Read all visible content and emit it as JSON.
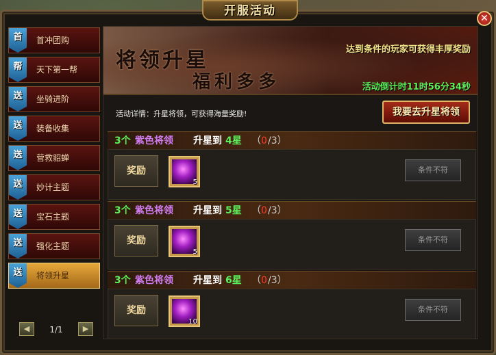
{
  "window": {
    "title": "开服活动",
    "close_glyph": "✕"
  },
  "sidebar": {
    "items": [
      {
        "badge": "首",
        "label": "首冲团购",
        "active": false
      },
      {
        "badge": "帮",
        "label": "天下第一帮",
        "active": false
      },
      {
        "badge": "送",
        "label": "坐骑进阶",
        "active": false
      },
      {
        "badge": "送",
        "label": "装备收集",
        "active": false
      },
      {
        "badge": "送",
        "label": "营救貂蝉",
        "active": false
      },
      {
        "badge": "送",
        "label": "妙计主题",
        "active": false
      },
      {
        "badge": "送",
        "label": "宝石主题",
        "active": false
      },
      {
        "badge": "送",
        "label": "强化主题",
        "active": false
      },
      {
        "badge": "送",
        "label": "将领升星",
        "active": true
      }
    ],
    "pager": {
      "text": "1/1",
      "prev_glyph": "◀",
      "next_glyph": "▶"
    }
  },
  "banner": {
    "title_line1": "将领升星",
    "title_line2": "福利多多",
    "subtitle": "达到条件的玩家可获得丰厚奖励",
    "countdown": "活动倒计时11时56分34秒"
  },
  "description": "活动详情：升星将领，可获得海量奖励!",
  "goto_button": "我要去升星将领",
  "tasks": [
    {
      "count": "3个",
      "quality": "紫色将领",
      "action": "升星到",
      "target": "4星",
      "open": "（",
      "progress": "0",
      "total": "/3）",
      "reward_label": "奖励",
      "item_count": "5",
      "status": "条件不符"
    },
    {
      "count": "3个",
      "quality": "紫色将领",
      "action": "升星到",
      "target": "5星",
      "open": "（",
      "progress": "0",
      "total": "/3）",
      "reward_label": "奖励",
      "item_count": "5",
      "status": "条件不符"
    },
    {
      "count": "3个",
      "quality": "紫色将领",
      "action": "升星到",
      "target": "6星",
      "open": "（",
      "progress": "0",
      "total": "/3）",
      "reward_label": "奖励",
      "item_count": "10",
      "status": "条件不符"
    }
  ]
}
